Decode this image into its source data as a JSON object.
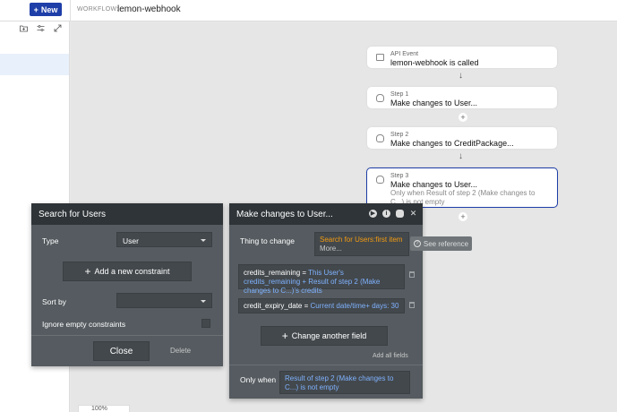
{
  "topbar": {
    "new_label": "New",
    "workflow_label": "WORKFLOW:",
    "workflow_name": "lemon-webhook"
  },
  "sidebar": {
    "icons": [
      "folder-plus-icon",
      "sliders-icon",
      "expand-icon"
    ]
  },
  "zoom": {
    "value": "100%"
  },
  "workflow": {
    "event": {
      "step_label": "API Event",
      "title": "lemon-webhook is called"
    },
    "steps": [
      {
        "step_label": "Step 1",
        "title": "Make changes to User..."
      },
      {
        "step_label": "Step 2",
        "title": "Make changes to CreditPackage..."
      },
      {
        "step_label": "Step 3",
        "title": "Make changes to User...",
        "condition": "Only when Result of step 2 (Make changes to C...) is not empty"
      }
    ]
  },
  "search_panel": {
    "title": "Search for Users",
    "type_label": "Type",
    "type_value": "User",
    "add_constraint_label": "Add a new constraint",
    "sort_by_label": "Sort by",
    "sort_by_value": "",
    "ignore_empty_label": "Ignore empty constraints",
    "close_label": "Close",
    "delete_label": "Delete"
  },
  "changes_panel": {
    "title": "Make changes to User...",
    "thing_label": "Thing to change",
    "thing_value": "Search for Users:first item",
    "thing_more": "More...",
    "see_reference": "See reference",
    "fields": [
      {
        "name": "credits_remaining",
        "eq": "=",
        "value": "This User's credits_remaining + Result of step 2 (Make changes to C...)'s credits"
      },
      {
        "name": "credit_expiry_date",
        "eq": "=",
        "value": "Current date/time+ days: 30"
      }
    ],
    "change_field_label": "Change another field",
    "add_all_fields": "Add all fields",
    "only_when_label": "Only when",
    "only_when_value": "Result of step 2 (Make changes to C...) is not empty"
  },
  "colors": {
    "accent": "#1e3ea8",
    "panel_bg": "#555b60",
    "panel_header": "#2f3438",
    "orange_text": "#f39c12",
    "blue_text": "#7fb2ff"
  }
}
